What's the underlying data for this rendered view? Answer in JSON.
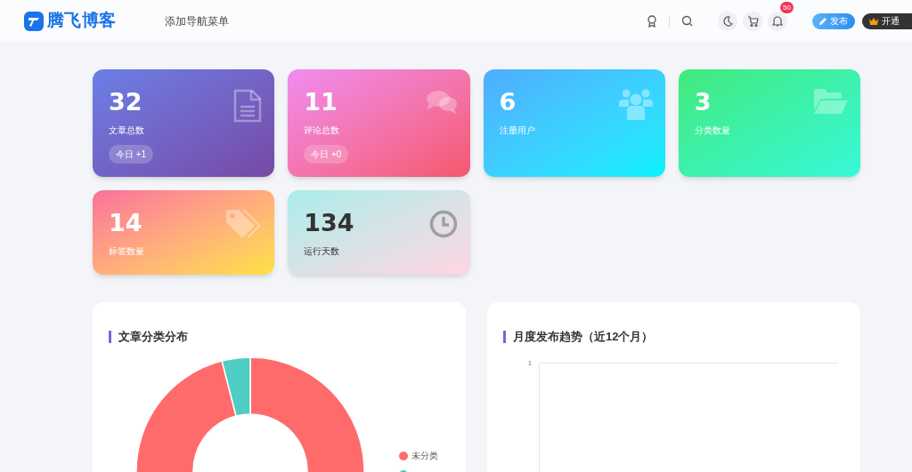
{
  "header": {
    "brand": "腾飞博客",
    "nav": [
      "添加导航菜单"
    ],
    "notification_count": "50",
    "publish_button": "发布",
    "vip_button": "开通"
  },
  "stats": [
    {
      "value": "32",
      "label": "文章总数",
      "badge": "今日 +1"
    },
    {
      "value": "11",
      "label": "评论总数",
      "badge": "今日 +0"
    },
    {
      "value": "6",
      "label": "注册用户"
    },
    {
      "value": "3",
      "label": "分类数量"
    },
    {
      "value": "14",
      "label": "标签数量"
    },
    {
      "value": "134",
      "label": "运行天数"
    }
  ],
  "category_panel": {
    "title": "文章分类分布",
    "legend": [
      {
        "label": "未分类",
        "color": "#ff6b6b"
      },
      {
        "color": "#4ecdc4"
      }
    ]
  },
  "trend_panel": {
    "title": "月度发布趋势（近12个月）",
    "y_tick": "1"
  }
}
